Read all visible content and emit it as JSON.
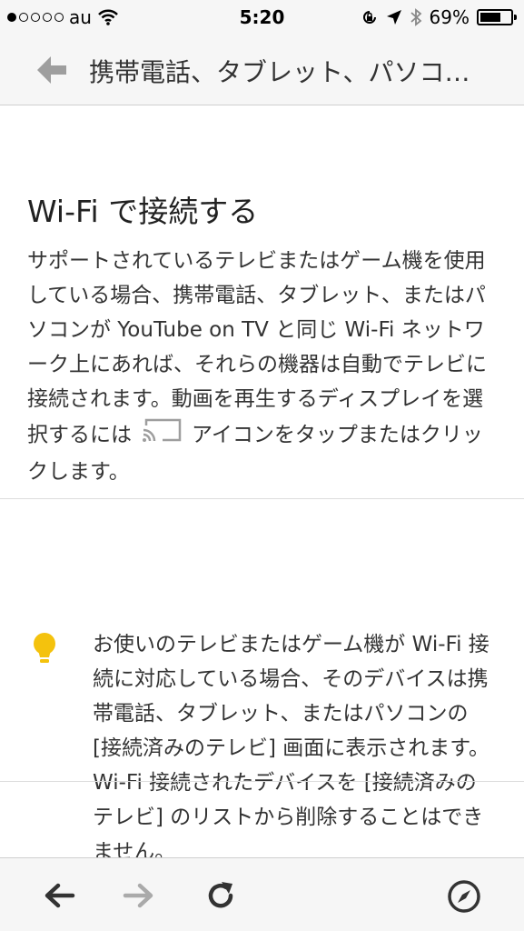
{
  "status_bar": {
    "carrier": "au",
    "time": "5:20",
    "battery_percent_text": "69%",
    "battery_level": 0.69,
    "signal_bars_filled": 1,
    "signal_bars_total": 5
  },
  "header": {
    "title": "携帯電話、タブレット、パソコ…"
  },
  "section": {
    "title": "Wi-Fi で接続する",
    "body_before_icon": "サポートされているテレビまたはゲーム機を使用している場合、携帯電話、タブレット、またはパソコンが YouTube on TV と同じ Wi-Fi ネットワーク上にあれば、それらの機器は自動でテレビに接続されます。動画を再生するディスプレイを選択するには",
    "body_after_icon": "アイコンをタップまたはクリックします。"
  },
  "tip": {
    "text": "お使いのテレビまたはゲーム機が Wi-Fi 接続に対応している場合、そのデバイスは携帯電話、タブレット、またはパソコンの [接続済みのテレビ] 画面に表示されます。Wi-Fi 接続されたデバイスを [接続済みのテレビ] のリストから削除することはできません。"
  },
  "colors": {
    "bulb": "#f4c20d",
    "icon_gray": "#9e9e9e",
    "toolbar_icon": "#333333",
    "toolbar_icon_disabled": "#aaaaaa"
  },
  "icons": {
    "header_back": "back-arrow-icon",
    "cast": "cast-icon",
    "tip": "lightbulb-icon",
    "toolbar": [
      "back-arrow-icon",
      "forward-arrow-icon",
      "reload-icon",
      "compass-icon"
    ]
  }
}
